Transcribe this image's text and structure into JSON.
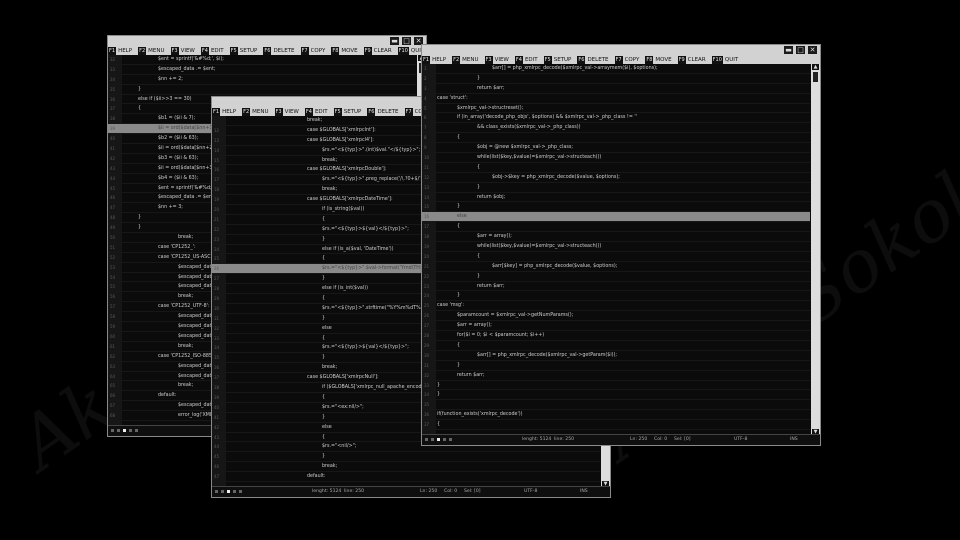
{
  "watermark": "Akato Sokolov",
  "menu": [
    {
      "key": "F1",
      "label": "HELP"
    },
    {
      "key": "F2",
      "label": "MENU"
    },
    {
      "key": "F3",
      "label": "VIEW"
    },
    {
      "key": "F4",
      "label": "EDIT"
    },
    {
      "key": "F5",
      "label": "SETUP"
    },
    {
      "key": "F6",
      "label": "DELETE"
    },
    {
      "key": "F7",
      "label": "COPY"
    },
    {
      "key": "F8",
      "label": "MOVE"
    },
    {
      "key": "F9",
      "label": "CLEAR"
    },
    {
      "key": "F10",
      "label": "QUIT"
    }
  ],
  "windows": [
    {
      "id": "left",
      "highlight": 7,
      "status": {
        "length": "",
        "lines": "",
        "ln": "",
        "col": "",
        "sel": "",
        "enc": "",
        "mode": ""
      },
      "lines": [
        {
          "n": "32",
          "t": "$ent = sprintf('&#%d;', $i);",
          "i": 1
        },
        {
          "n": "33",
          "t": "$escaped_data .= $ent;",
          "i": 1
        },
        {
          "n": "34",
          "t": "$nn += 2;",
          "i": 1
        },
        {
          "n": "35",
          "t": "}",
          "i": 0
        },
        {
          "n": "36",
          "t": "else if ($ii>>3 == 30)",
          "i": 0
        },
        {
          "n": "37",
          "t": "{",
          "i": 0
        },
        {
          "n": "38",
          "t": "$b1 = ($ii & 7);",
          "i": 1
        },
        {
          "n": "39",
          "t": "$ii = ord($data[$nn+1]);",
          "i": 1
        },
        {
          "n": "40",
          "t": "$b2 = ($ii & 63);",
          "i": 1
        },
        {
          "n": "41",
          "t": "$ii = ord($data[$nn+2]);",
          "i": 1
        },
        {
          "n": "42",
          "t": "$b3 = ($ii & 63);",
          "i": 1
        },
        {
          "n": "43",
          "t": "$ii = ord($data[$nn+3]);",
          "i": 1
        },
        {
          "n": "44",
          "t": "$b4 = ($ii & 63);",
          "i": 1
        },
        {
          "n": "45",
          "t": "$ent = sprintf('&#%d;', $ii);",
          "i": 1
        },
        {
          "n": "46",
          "t": "$escaped_data .= $ent;",
          "i": 1
        },
        {
          "n": "47",
          "t": "$nn += 3;",
          "i": 1
        },
        {
          "n": "48",
          "t": "}",
          "i": 0
        },
        {
          "n": "49",
          "t": "}",
          "i": 0
        },
        {
          "n": "50",
          "t": "break;",
          "i": 2
        },
        {
          "n": "51",
          "t": "case 'CP1252_':",
          "i": 1
        },
        {
          "n": "52",
          "t": "case 'CP1252_US-ASCII':",
          "i": 1
        },
        {
          "n": "53",
          "t": "$escaped_data",
          "i": 2
        },
        {
          "n": "54",
          "t": "$escaped_data",
          "i": 2
        },
        {
          "n": "55",
          "t": "$escaped_data",
          "i": 2
        },
        {
          "n": "56",
          "t": "break;",
          "i": 2
        },
        {
          "n": "57",
          "t": "case 'CP1252_UTF-8':",
          "i": 1
        },
        {
          "n": "58",
          "t": "$escaped_data",
          "i": 2
        },
        {
          "n": "59",
          "t": "$escaped_data",
          "i": 2
        },
        {
          "n": "60",
          "t": "$escaped_data",
          "i": 2
        },
        {
          "n": "61",
          "t": "break;",
          "i": 2
        },
        {
          "n": "62",
          "t": "case 'CP1252_ISO-8859-",
          "i": 1
        },
        {
          "n": "63",
          "t": "$escaped_data",
          "i": 2
        },
        {
          "n": "64",
          "t": "$escaped_data",
          "i": 2
        },
        {
          "n": "65",
          "t": "break;",
          "i": 2
        },
        {
          "n": "66",
          "t": "default:",
          "i": 1
        },
        {
          "n": "67",
          "t": "$escaped_data",
          "i": 2
        },
        {
          "n": "68",
          "t": "error_log('XML-",
          "i": 2
        }
      ]
    },
    {
      "id": "middle",
      "highlight": 15,
      "status": {
        "length": "lenght: 5124",
        "lines": "line: 250",
        "ln": "Ln: 250",
        "col": "Col: 0",
        "sel": "Sel: [0]",
        "enc": "UTF-8",
        "mode": "INS"
      },
      "lines": [
        {
          "n": "",
          "t": "break;",
          "i": 1
        },
        {
          "n": "12",
          "t": "case $GLOBALS['xmlrpcInt']:",
          "i": 1
        },
        {
          "n": "13",
          "t": "case $GLOBALS['xmlrpcI4']:",
          "i": 1
        },
        {
          "n": "14",
          "t": "$rs.=\"<${typ}>\".(int)$val.\"</${typ}>\";",
          "i": 2
        },
        {
          "n": "15",
          "t": "break;",
          "i": 2
        },
        {
          "n": "16",
          "t": "case $GLOBALS['xmlrpcDouble']:",
          "i": 1
        },
        {
          "n": "17",
          "t": "$rs.=\"<${typ}>\".preg_replace('/\\.?0+$/','',number_format(",
          "i": 2
        },
        {
          "n": "18",
          "t": "break;",
          "i": 2
        },
        {
          "n": "19",
          "t": "case $GLOBALS['xmlrpcDateTime']:",
          "i": 1
        },
        {
          "n": "20",
          "t": "if (is_string($val))",
          "i": 2
        },
        {
          "n": "21",
          "t": "{",
          "i": 2
        },
        {
          "n": "22",
          "t": "$rs.=\"<${typ}>${val}</${typ}>\";",
          "i": 3
        },
        {
          "n": "23",
          "t": "}",
          "i": 2
        },
        {
          "n": "24",
          "t": "else if (is_a($val, 'DateTime'))",
          "i": 2
        },
        {
          "n": "25",
          "t": "{",
          "i": 2
        },
        {
          "n": "26",
          "t": "$rs.=\"<${typ}>\".$val->format('Ymd\\TH:i:s').\"</${ty",
          "i": 3
        },
        {
          "n": "27",
          "t": "}",
          "i": 2
        },
        {
          "n": "28",
          "t": "else if (is_int($val))",
          "i": 2
        },
        {
          "n": "29",
          "t": "{",
          "i": 2
        },
        {
          "n": "30",
          "t": "$rs.=\"<${typ}>\".strftime(\"%Y%m%dT%H:%M:%S\",",
          "i": 3
        },
        {
          "n": "31",
          "t": "}",
          "i": 2
        },
        {
          "n": "32",
          "t": "else",
          "i": 2
        },
        {
          "n": "33",
          "t": "{",
          "i": 2
        },
        {
          "n": "34",
          "t": "$rs.=\"<${typ}>${val}</${typ}>\";",
          "i": 3
        },
        {
          "n": "35",
          "t": "}",
          "i": 2
        },
        {
          "n": "36",
          "t": "break;",
          "i": 2
        },
        {
          "n": "37",
          "t": "case $GLOBALS['xmlrpcNull']:",
          "i": 1
        },
        {
          "n": "38",
          "t": "if ($GLOBALS['xmlrpc_null_apache_encoding'])",
          "i": 2
        },
        {
          "n": "39",
          "t": "{",
          "i": 2
        },
        {
          "n": "40",
          "t": "$rs.=\"<ex:nil/>\";",
          "i": 3
        },
        {
          "n": "41",
          "t": "}",
          "i": 2
        },
        {
          "n": "42",
          "t": "else",
          "i": 2
        },
        {
          "n": "43",
          "t": "{",
          "i": 2
        },
        {
          "n": "44",
          "t": "$rs.=\"<nil/>\";",
          "i": 3
        },
        {
          "n": "45",
          "t": "}",
          "i": 2
        },
        {
          "n": "46",
          "t": "break;",
          "i": 2
        },
        {
          "n": "47",
          "t": "default:",
          "i": 1
        }
      ]
    },
    {
      "id": "right",
      "highlight": 15,
      "status": {
        "length": "lenght: 5124",
        "lines": "line: 250",
        "ln": "Ln: 250",
        "col": "Col: 0",
        "sel": "Sel: [0]",
        "enc": "UTF-8",
        "mode": "INS"
      },
      "lines": [
        {
          "n": "1",
          "t": "$arr[] = php_xmlrpc_decode($xmlrpc_val->arraymem($i), $options);",
          "i": 3
        },
        {
          "n": "2",
          "t": "}",
          "i": 2
        },
        {
          "n": "3",
          "t": "return $arr;",
          "i": 2
        },
        {
          "n": "4",
          "t": "case 'struct':",
          "i": 0
        },
        {
          "n": "5",
          "t": "$xmlrpc_val->structreset();",
          "i": 1
        },
        {
          "n": "6",
          "t": "if (in_array('decode_php_objs', $options) && $xmlrpc_val->_php_class != ''",
          "i": 1
        },
        {
          "n": "7",
          "t": "&& class_exists($xmlrpc_val->_php_class))",
          "i": 2
        },
        {
          "n": "8",
          "t": "{",
          "i": 1
        },
        {
          "n": "9",
          "t": "$obj = @new $xmlrpc_val->_php_class;",
          "i": 2
        },
        {
          "n": "10",
          "t": "while(list($key,$value)=$xmlrpc_val->structeach())",
          "i": 2
        },
        {
          "n": "11",
          "t": "{",
          "i": 2
        },
        {
          "n": "12",
          "t": "$obj->$key = php_xmlrpc_decode($value, $options);",
          "i": 3
        },
        {
          "n": "13",
          "t": "}",
          "i": 2
        },
        {
          "n": "14",
          "t": "return $obj;",
          "i": 2
        },
        {
          "n": "15",
          "t": "}",
          "i": 1
        },
        {
          "n": "16",
          "t": "else",
          "i": 1
        },
        {
          "n": "17",
          "t": "{",
          "i": 1
        },
        {
          "n": "18",
          "t": "$arr = array();",
          "i": 2
        },
        {
          "n": "19",
          "t": "while(list($key,$value)=$xmlrpc_val->structeach())",
          "i": 2
        },
        {
          "n": "20",
          "t": "{",
          "i": 2
        },
        {
          "n": "21",
          "t": "$arr[$key] = php_xmlrpc_decode($value, $options);",
          "i": 3
        },
        {
          "n": "22",
          "t": "}",
          "i": 2
        },
        {
          "n": "23",
          "t": "return $arr;",
          "i": 2
        },
        {
          "n": "24",
          "t": "}",
          "i": 1
        },
        {
          "n": "25",
          "t": "case 'msg':",
          "i": 0
        },
        {
          "n": "26",
          "t": "$paramcount = $xmlrpc_val->getNumParams();",
          "i": 1
        },
        {
          "n": "27",
          "t": "$arr = array();",
          "i": 1
        },
        {
          "n": "28",
          "t": "for($i = 0; $i < $paramcount; $i++)",
          "i": 1
        },
        {
          "n": "29",
          "t": "{",
          "i": 1
        },
        {
          "n": "30",
          "t": "$arr[] = php_xmlrpc_decode($xmlrpc_val->getParam($i));",
          "i": 2
        },
        {
          "n": "31",
          "t": "}",
          "i": 1
        },
        {
          "n": "32",
          "t": "return $arr;",
          "i": 1
        },
        {
          "n": "33",
          "t": "}",
          "i": 0
        },
        {
          "n": "34",
          "t": "}",
          "i": 0
        },
        {
          "n": "35",
          "t": "",
          "i": 0
        },
        {
          "n": "36",
          "t": "if(function_exists('xmlrpc_decode'))",
          "i": 0
        },
        {
          "n": "37",
          "t": "{",
          "i": 0
        }
      ]
    }
  ]
}
